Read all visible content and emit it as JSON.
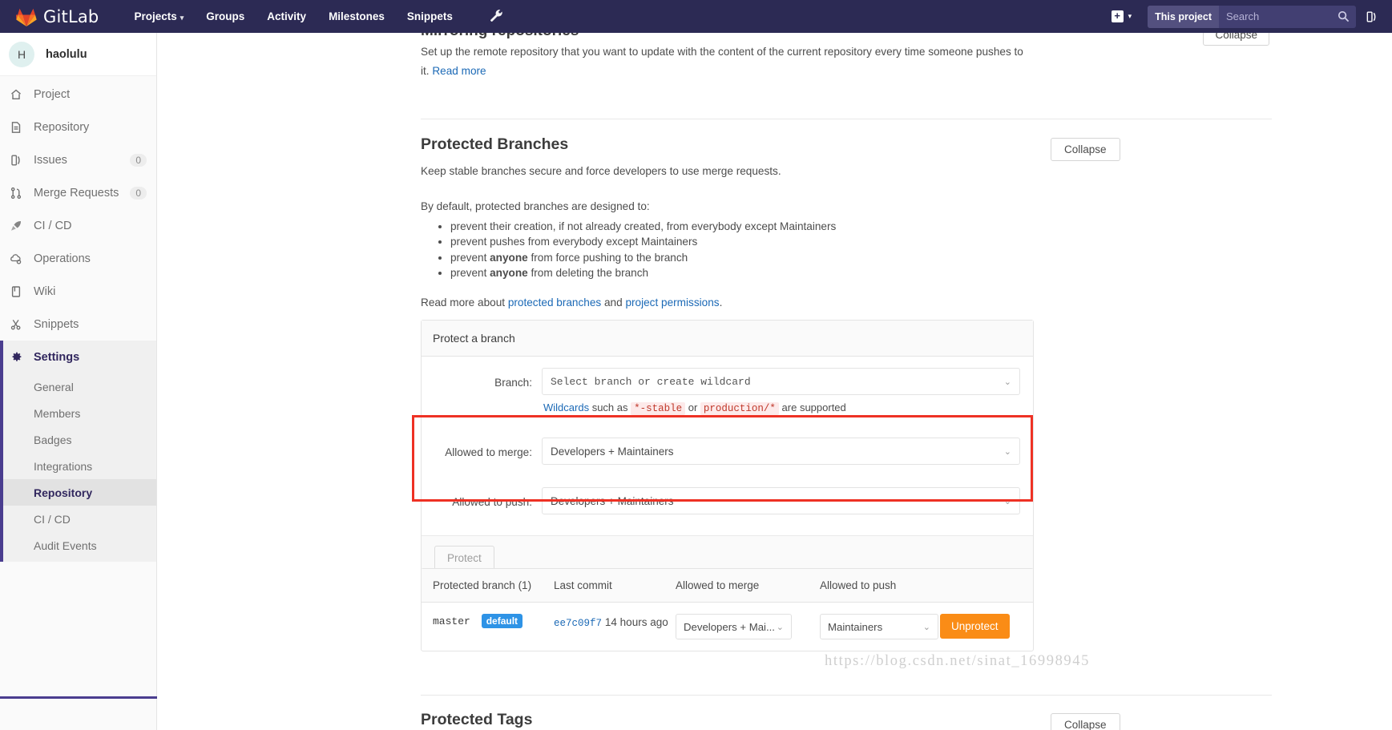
{
  "navbar": {
    "brand": "GitLab",
    "logo_icon": "gitlab-fox-logo-icon",
    "links": [
      {
        "label": "Projects",
        "has_caret": true
      },
      {
        "label": "Groups",
        "has_caret": false
      },
      {
        "label": "Activity",
        "has_caret": false
      },
      {
        "label": "Milestones",
        "has_caret": false
      },
      {
        "label": "Snippets",
        "has_caret": false
      }
    ],
    "wrench_icon": "wrench-icon",
    "plus_icon": "plus-square-icon",
    "plus_caret_icon": "chevron-down-icon",
    "search_scope": "This project",
    "search_placeholder": "Search",
    "search_value": "",
    "search_icon": "search-magnifier-icon",
    "issues_icon": "issue-book-icon",
    "bg_color": "#2c2a54"
  },
  "sidebar": {
    "avatar_initial": "H",
    "project_name": "haolulu",
    "items": [
      {
        "label": "Project",
        "icon": "home-icon",
        "badge": ""
      },
      {
        "label": "Repository",
        "icon": "document-icon",
        "badge": ""
      },
      {
        "label": "Issues",
        "icon": "issue-book-icon",
        "badge": "0"
      },
      {
        "label": "Merge Requests",
        "icon": "merge-request-icon",
        "badge": "0"
      },
      {
        "label": "CI / CD",
        "icon": "rocket-icon",
        "badge": ""
      },
      {
        "label": "Operations",
        "icon": "cloud-gear-icon",
        "badge": ""
      },
      {
        "label": "Wiki",
        "icon": "book-icon",
        "badge": ""
      },
      {
        "label": "Snippets",
        "icon": "scissors-icon",
        "badge": ""
      }
    ],
    "settings": {
      "label": "Settings",
      "icon": "gear-icon"
    },
    "sub_items": [
      {
        "label": "General",
        "active": false
      },
      {
        "label": "Members",
        "active": false
      },
      {
        "label": "Badges",
        "active": false
      },
      {
        "label": "Integrations",
        "active": false
      },
      {
        "label": "Repository",
        "active": true
      },
      {
        "label": "CI / CD",
        "active": false
      },
      {
        "label": "Audit Events",
        "active": false
      }
    ],
    "accent_color": "#4a3d8f"
  },
  "main": {
    "cut_heading": "Mirroring repositories",
    "cut_collapse_label": "Collapse",
    "mirror_desc_text": "Set up the remote repository that you want to update with the content of the current repository every time someone pushes to it. ",
    "mirror_desc_link": "Read more",
    "protected_branches": {
      "title": "Protected Branches",
      "collapse_label": "Collapse",
      "subtitle": "Keep stable branches secure and force developers to use merge requests.",
      "by_default": "By default, protected branches are designed to:",
      "bullets": [
        "prevent their creation, if not already created, from everybody except Maintainers",
        "prevent pushes from everybody except Maintainers",
        "prevent anyone from force pushing to the branch",
        "prevent anyone from deleting the branch"
      ],
      "bullet_bold_word": "anyone",
      "read_more_prefix": "Read more about ",
      "read_more_link1": "protected branches",
      "read_more_mid": " and ",
      "read_more_link2": "project permissions",
      "read_more_suffix": "."
    },
    "protect_form": {
      "panel_title": "Protect a branch",
      "branch_label": "Branch:",
      "branch_value": "Select branch or create wildcard",
      "hint_link": "Wildcards",
      "hint_mid1": " such as ",
      "hint_code1": "*-stable",
      "hint_mid2": " or ",
      "hint_code2": "production/*",
      "hint_suffix": " are supported",
      "allowed_merge_label": "Allowed to merge:",
      "allowed_merge_value": "Developers + Maintainers",
      "allowed_push_label": "Allowed to push:",
      "allowed_push_value": "Developers + Maintainers",
      "protect_button": "Protect",
      "chevron_icon": "chevron-down-icon",
      "annotation_color": "#ee3124"
    },
    "protected_table": {
      "headers": [
        "Protected branch (1)",
        "Last commit",
        "Allowed to merge",
        "Allowed to push"
      ],
      "rows": [
        {
          "branch": "master",
          "badge": "default",
          "commit_sha": "ee7c09f7",
          "commit_time": "14 hours ago",
          "allowed_merge": "Developers + Mai...",
          "allowed_push": "Maintainers",
          "action_label": "Unprotect"
        }
      ],
      "action_color": "#fa8c16",
      "badge_color": "#2e93e6"
    },
    "protected_tags": {
      "title": "Protected Tags",
      "collapse_label": "Collapse"
    },
    "watermark": "https://blog.csdn.net/sinat_16998945"
  }
}
